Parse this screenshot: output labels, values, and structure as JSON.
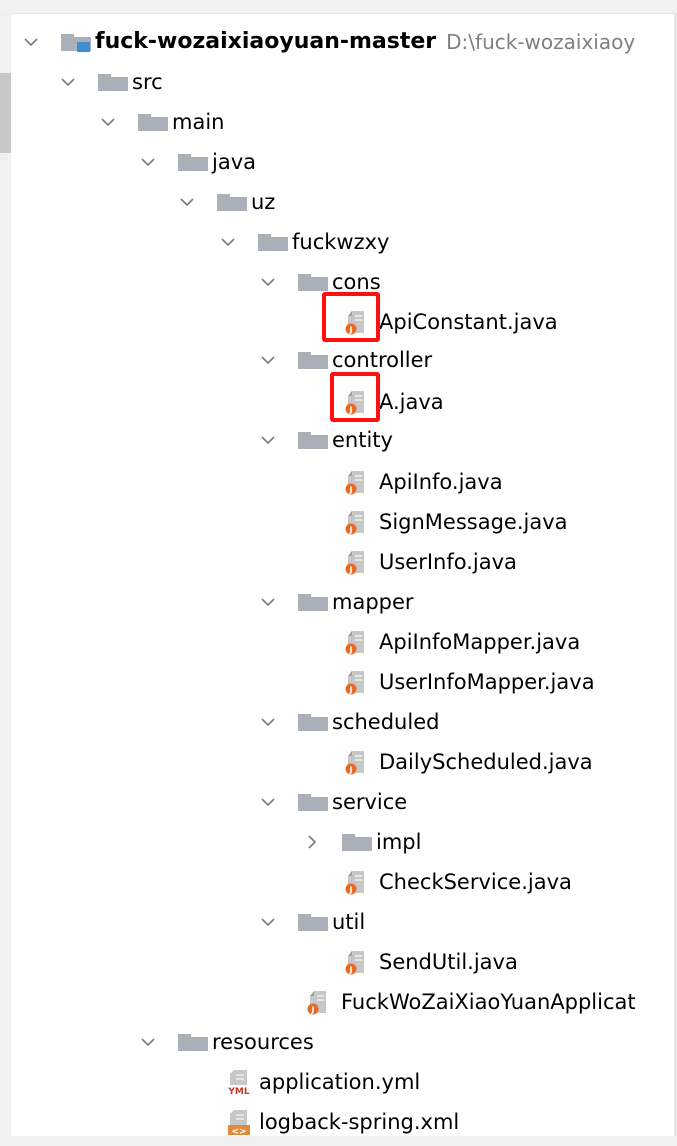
{
  "project": {
    "name": "fuck-wozaixiaoyuan-master",
    "path": "D:\\fuck-wozaixiaoy"
  },
  "tree": {
    "src": "src",
    "main": "main",
    "java": "java",
    "uz": "uz",
    "fuckwzxy": "fuckwzxy",
    "cons": "cons",
    "api_constant": "ApiConstant.java",
    "controller": "controller",
    "a_java": "A.java",
    "entity": "entity",
    "api_info": "ApiInfo.java",
    "sign_message": "SignMessage.java",
    "user_info": "UserInfo.java",
    "mapper": "mapper",
    "api_info_mapper": "ApiInfoMapper.java",
    "user_info_mapper": "UserInfoMapper.java",
    "scheduled": "scheduled",
    "daily_scheduled": "DailyScheduled.java",
    "service": "service",
    "impl": "impl",
    "check_service": "CheckService.java",
    "util": "util",
    "send_util": "SendUtil.java",
    "app_class": "FuckWoZaiXiaoYuanApplicat",
    "resources": "resources",
    "application_yml": "application.yml",
    "logback_xml": "logback-spring.xml"
  },
  "icons": {
    "expanded": "chevron-down-icon",
    "collapsed": "chevron-right-icon",
    "folder": "folder-icon",
    "java_file": "java-file-icon",
    "yml_file": "yml-file-icon",
    "xml_file": "xml-file-icon",
    "yml_badge": "YML",
    "xml_badge": "<>"
  },
  "colors": {
    "folder": "#a9b0b9",
    "module_badge": "#3c8fd3",
    "java_badge": "#e36b23",
    "highlight": "#ff1010",
    "path_text": "#808080"
  }
}
